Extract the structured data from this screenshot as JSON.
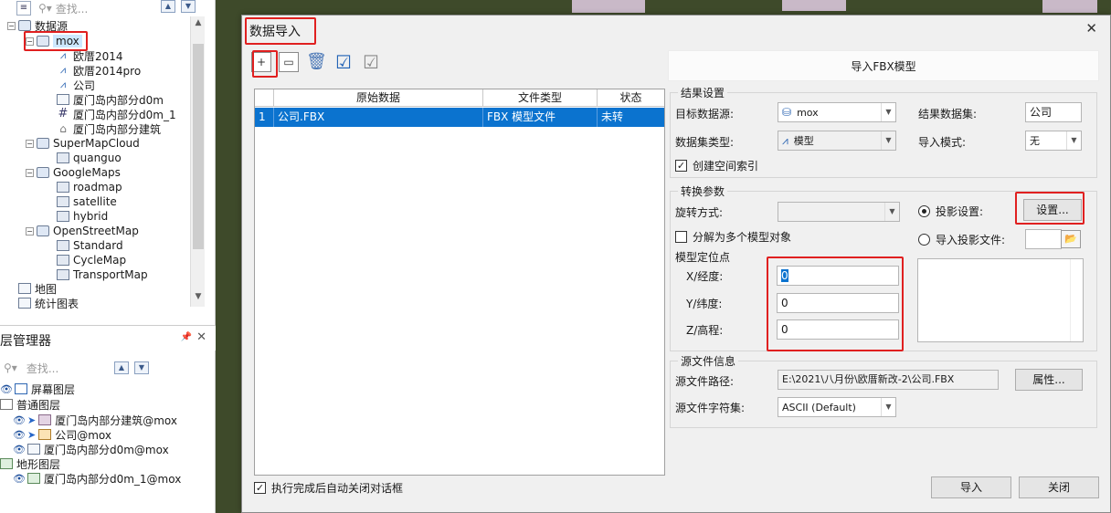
{
  "left_panel": {
    "search_placeholder": "查找...",
    "tree": {
      "root": "数据源",
      "datasource": "mox",
      "datasets": [
        "欧厝2014",
        "欧厝2014pro",
        "公司",
        "厦门岛内部分d0m",
        "厦门岛内部分d0m_1",
        "厦门岛内部分建筑"
      ],
      "cloud_sources": [
        {
          "name": "SuperMapCloud",
          "children": [
            "quanguo"
          ]
        },
        {
          "name": "GoogleMaps",
          "children": [
            "roadmap",
            "satellite",
            "hybrid"
          ]
        },
        {
          "name": "OpenStreetMap",
          "children": [
            "Standard",
            "CycleMap",
            "TransportMap"
          ]
        }
      ],
      "map": "地图",
      "chart": "统计图表"
    }
  },
  "layer_manager": {
    "title": "层管理器",
    "search_placeholder": "查找...",
    "screen_layers": "屏幕图层",
    "normal_layers": "普通图层",
    "layers": [
      "厦门岛内部分建筑@mox",
      "公司@mox",
      "厦门岛内部分d0m@mox"
    ],
    "terrain_layers": "地形图层",
    "terrain": [
      "厦门岛内部分d0m_1@mox"
    ]
  },
  "dialog": {
    "title": "数据导入",
    "close": "✕",
    "table": {
      "headers": [
        "原始数据",
        "文件类型",
        "状态"
      ],
      "rows": [
        {
          "index": "1",
          "source": "公司.FBX",
          "type": "FBX 模型文件",
          "status": "未转"
        }
      ]
    },
    "panel_title": "导入FBX模型",
    "result": {
      "group": "结果设置",
      "target_ds_label": "目标数据源:",
      "target_ds_value": "mox",
      "result_dataset_label": "结果数据集:",
      "result_dataset_value": "公司",
      "dataset_type_label": "数据集类型:",
      "dataset_type_value": "模型",
      "import_mode_label": "导入模式:",
      "import_mode_value": "无",
      "spatial_index": "创建空间索引"
    },
    "convert": {
      "group": "转换参数",
      "rotation_label": "旋转方式:",
      "split_models": "分解为多个模型对象",
      "anchor_label": "模型定位点",
      "x_label": "X/经度:",
      "x_value": "0",
      "y_label": "Y/纬度:",
      "y_value": "0",
      "z_label": "Z/高程:",
      "z_value": "0",
      "proj_setting": "投影设置:",
      "proj_button": "设置...",
      "import_proj_file": "导入投影文件:"
    },
    "source": {
      "group": "源文件信息",
      "path_label": "源文件路径:",
      "path_value": "E:\\2021\\八月份\\欧厝新改-2\\公司.FBX",
      "props_button": "属性...",
      "charset_label": "源文件字符集:",
      "charset_value": "ASCII (Default)"
    },
    "auto_close": "执行完成后自动关闭对话框",
    "import_button": "导入",
    "close_button": "关闭"
  },
  "colors": {
    "selection": "#0b73cf",
    "highlight_box": "#e02020"
  }
}
